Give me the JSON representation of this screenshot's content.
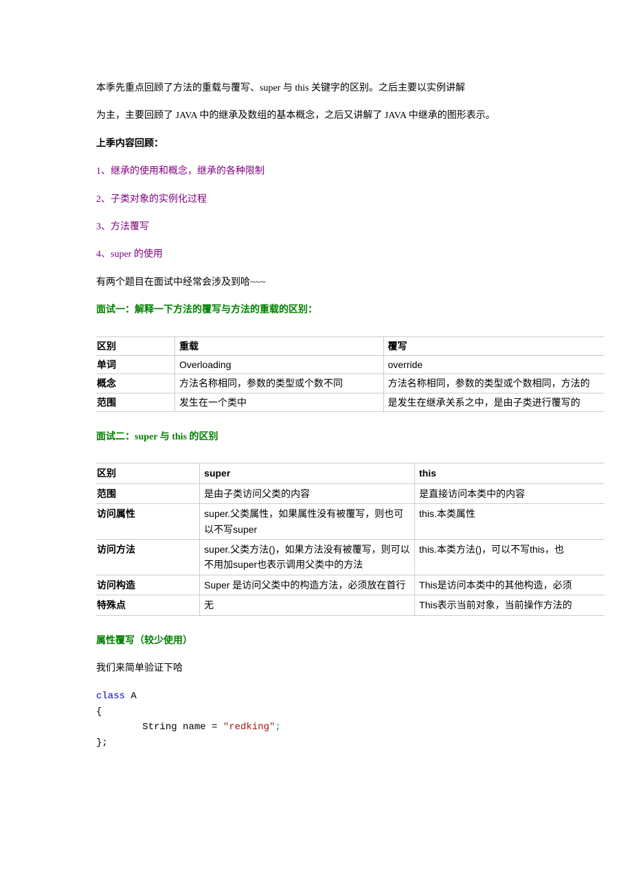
{
  "intro": {
    "line1": "本季先重点回顾了方法的重载与覆写、super 与 this 关键字的区别。之后主要以实例讲解",
    "line2": "为主，主要回顾了 JAVA 中的继承及数组的基本概念，之后又讲解了 JAVA 中继承的图形表示。"
  },
  "section1_title": "上季内容回顾：",
  "review_items": [
    "1、继承的使用和概念，继承的各种限制",
    "2、子类对象的实例化过程",
    "3、方法覆写",
    "4、super 的使用"
  ],
  "interview_intro": "有两个题目在面试中经常会涉及到哈~~~",
  "interview1_title": "面试一：解释一下方法的覆写与方法的重载的区别：",
  "table1": {
    "header": {
      "c1": "区别",
      "c2": "重载",
      "c3": "覆写"
    },
    "rows": [
      {
        "c1": "单词",
        "c2": "Overloading",
        "c3": "override"
      },
      {
        "c1": "概念",
        "c2": "方法名称相同，参数的类型或个数不同",
        "c3": "方法名称相同，参数的类型或个数相同，方法的"
      },
      {
        "c1": "范围",
        "c2": "发生在一个类中",
        "c3": "是发生在继承关系之中，是由子类进行覆写的"
      }
    ]
  },
  "interview2_title": "面试二：super 与 this 的区别",
  "table2": {
    "header": {
      "c1": "区别",
      "c2": "super",
      "c3": "this"
    },
    "rows": [
      {
        "c1": "范围",
        "c2": "是由子类访问父类的内容",
        "c3": "是直接访问本类中的内容"
      },
      {
        "c1": "访问属性",
        "c2": "super.父类属性，如果属性没有被覆写，则也可以不写super",
        "c3": "this.本类属性"
      },
      {
        "c1": "访问方法",
        "c2": "super.父类方法()，如果方法没有被覆写，则可以不用加super也表示调用父类中的方法",
        "c3": "this.本类方法()，可以不写this，也"
      },
      {
        "c1": "访问构造",
        "c2": "Super 是访问父类中的构造方法，必须放在首行",
        "c3": "This是访问本类中的其他构造，必须"
      },
      {
        "c1": "特殊点",
        "c2": "无",
        "c3": "This表示当前对象，当前操作方法的"
      }
    ]
  },
  "attr_override_title": "属性覆写（较少使用）",
  "attr_override_text": "我们来简单验证下哈",
  "code": {
    "kw_class": "class",
    "cls_name": " A",
    "brace_open": "{",
    "indent": "        ",
    "var_decl": "String name = ",
    "str_q1": "\"",
    "str_val": "redking",
    "str_q2": "\"",
    "semi": ";",
    "brace_close": "};"
  }
}
